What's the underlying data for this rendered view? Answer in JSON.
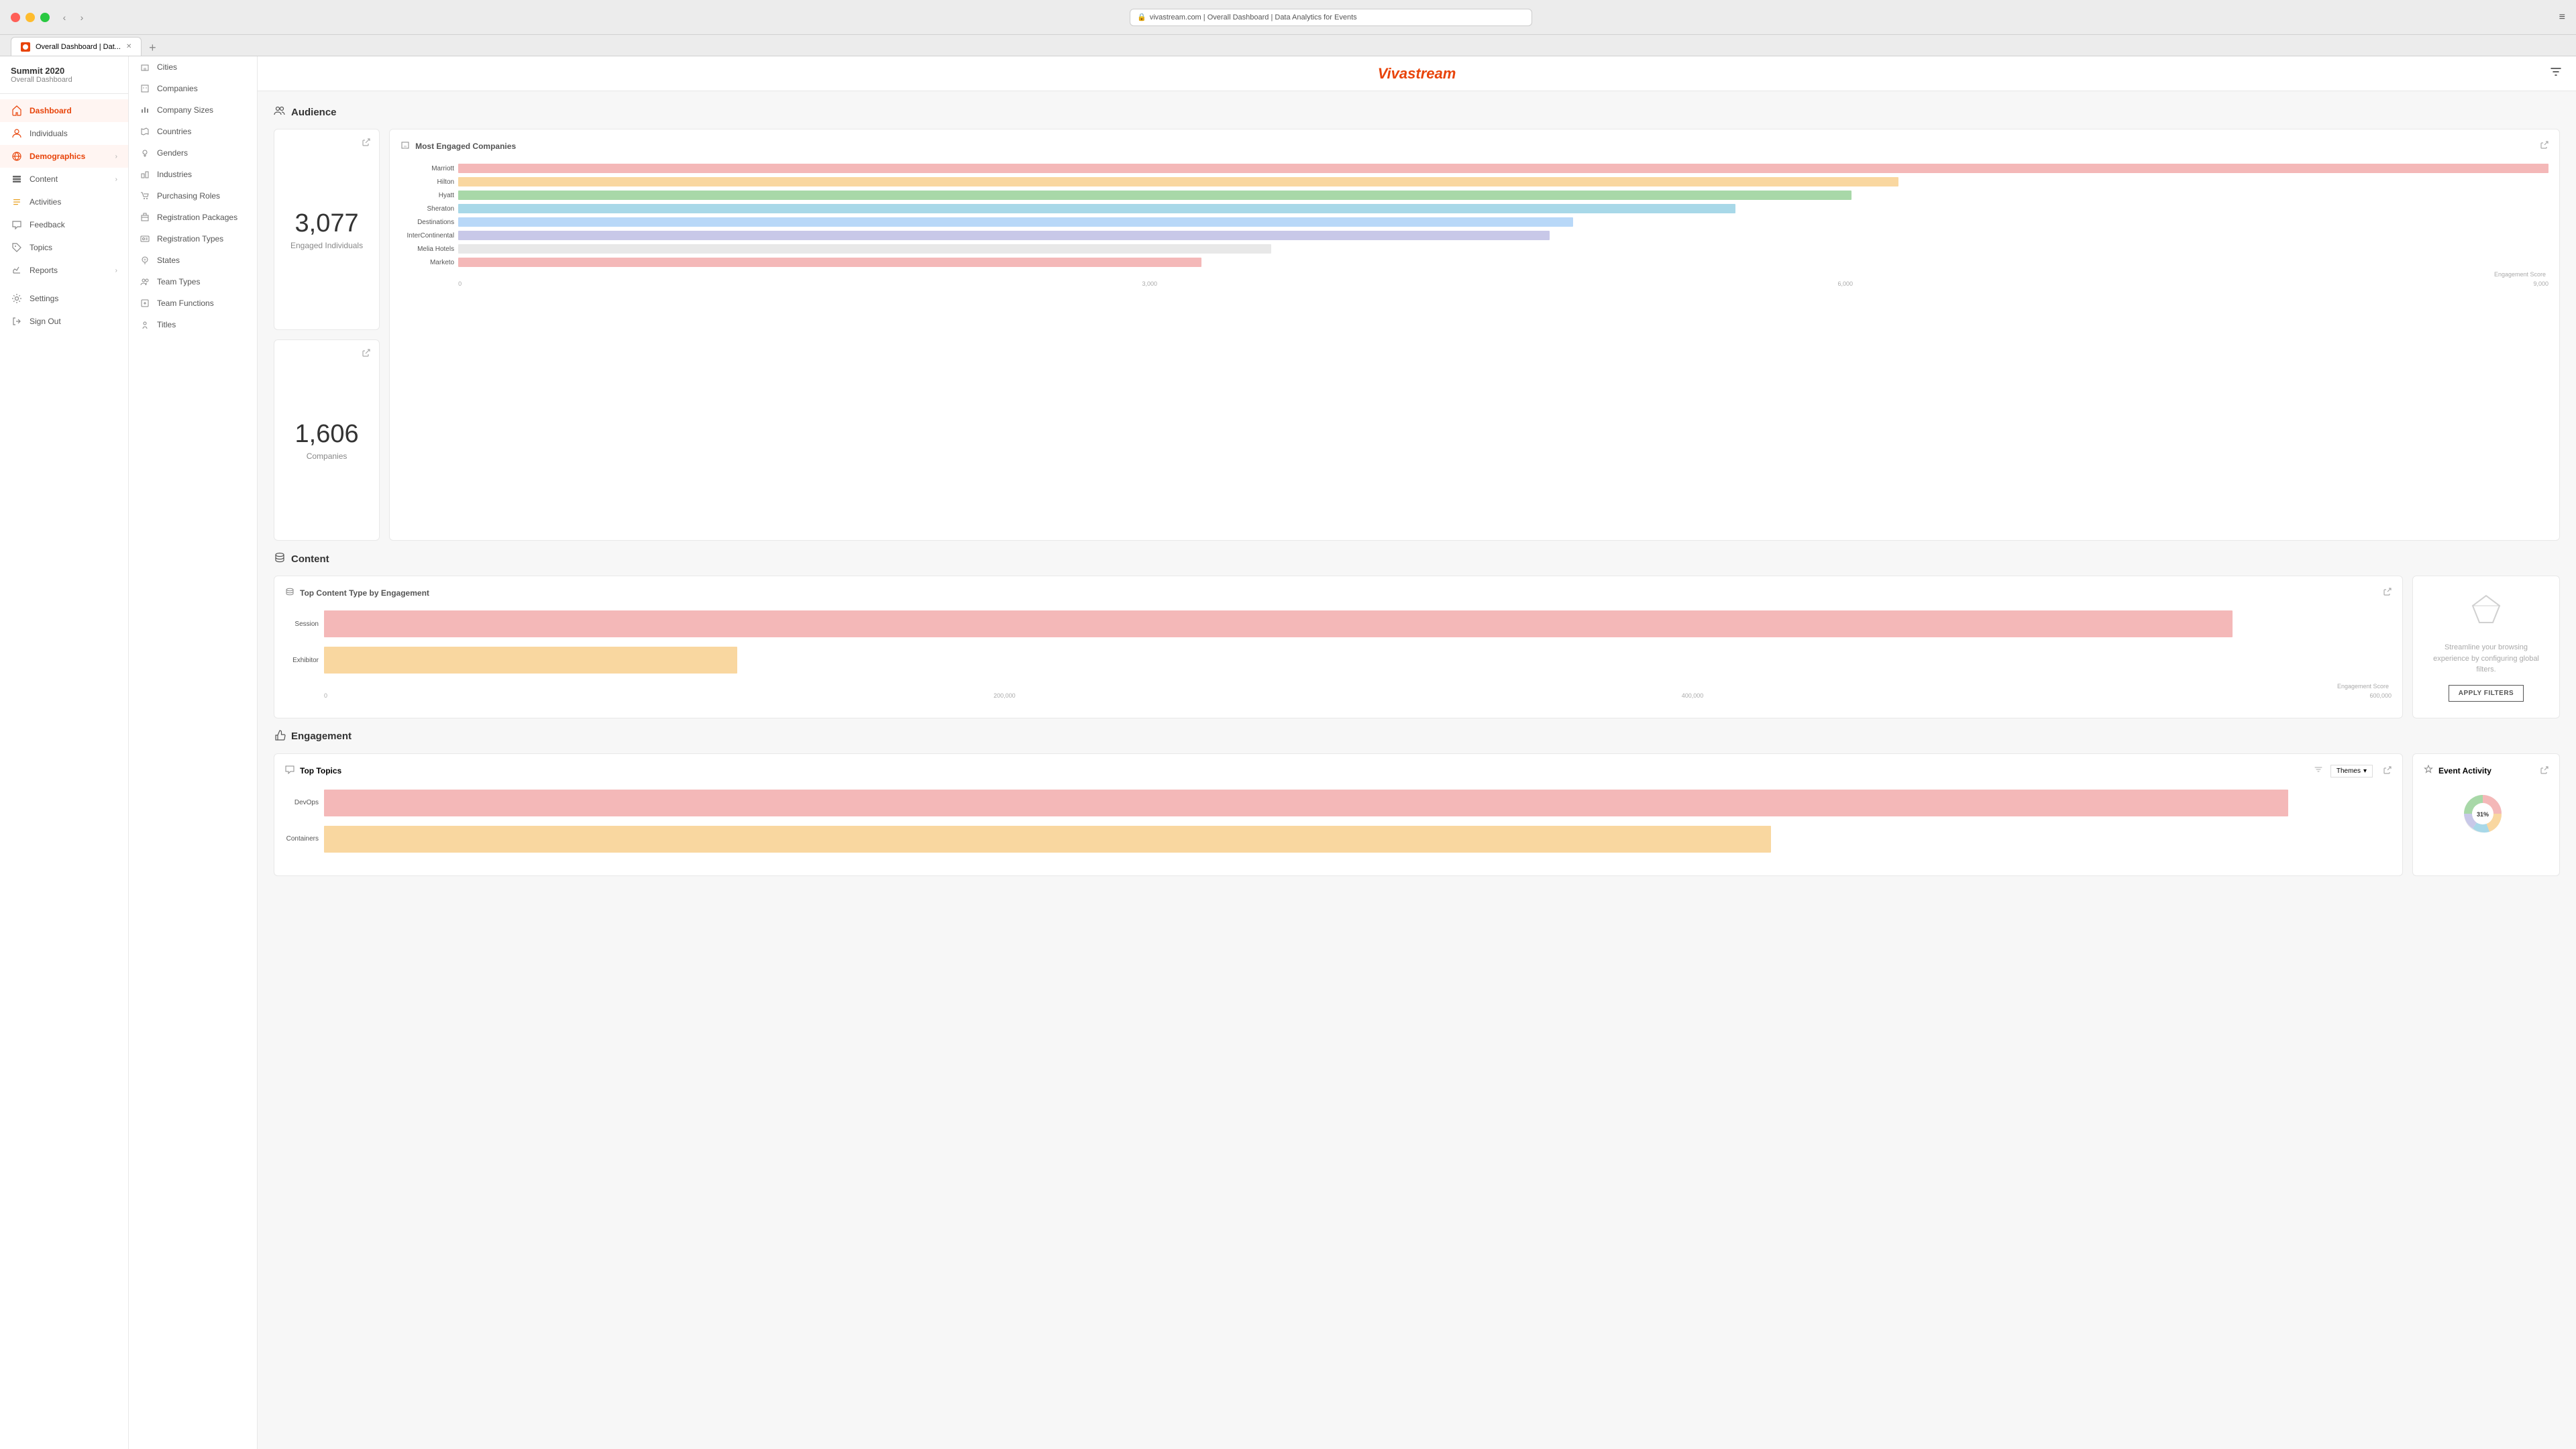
{
  "browser": {
    "url": "vivastream.com | Overall Dashboard | Data Analytics for Events",
    "tab_label": "Overall Dashboard | Dat...",
    "menu_icon": "≡"
  },
  "sidebar": {
    "app_name": "Summit 2020",
    "app_sub": "Overall Dashboard",
    "items": [
      {
        "id": "dashboard",
        "label": "Dashboard",
        "icon": "home",
        "active": true
      },
      {
        "id": "individuals",
        "label": "Individuals",
        "icon": "person"
      },
      {
        "id": "demographics",
        "label": "Demographics",
        "icon": "globe",
        "has_submenu": true,
        "active_sub": true
      },
      {
        "id": "content",
        "label": "Content",
        "icon": "layers",
        "has_submenu": true
      },
      {
        "id": "activities",
        "label": "Activities",
        "icon": "list"
      },
      {
        "id": "feedback",
        "label": "Feedback",
        "icon": "chat"
      },
      {
        "id": "topics",
        "label": "Topics",
        "icon": "tag"
      },
      {
        "id": "reports",
        "label": "Reports",
        "icon": "chart",
        "has_submenu": true
      },
      {
        "id": "settings",
        "label": "Settings",
        "icon": "gear"
      },
      {
        "id": "signout",
        "label": "Sign Out",
        "icon": "exit"
      }
    ]
  },
  "submenu": {
    "items": [
      {
        "id": "cities",
        "label": "Cities",
        "icon": "building"
      },
      {
        "id": "companies",
        "label": "Companies",
        "icon": "office"
      },
      {
        "id": "company-sizes",
        "label": "Company Sizes",
        "icon": "chart-bar"
      },
      {
        "id": "countries",
        "label": "Countries",
        "icon": "map"
      },
      {
        "id": "genders",
        "label": "Genders",
        "icon": "gender"
      },
      {
        "id": "industries",
        "label": "Industries",
        "icon": "industry"
      },
      {
        "id": "purchasing-roles",
        "label": "Purchasing Roles",
        "icon": "cart"
      },
      {
        "id": "registration-packages",
        "label": "Registration Packages",
        "icon": "package"
      },
      {
        "id": "registration-types",
        "label": "Registration Types",
        "icon": "id-card"
      },
      {
        "id": "states",
        "label": "States",
        "icon": "map-pin"
      },
      {
        "id": "team-types",
        "label": "Team Types",
        "icon": "team"
      },
      {
        "id": "team-functions",
        "label": "Team Functions",
        "icon": "function"
      },
      {
        "id": "titles",
        "label": "Titles",
        "icon": "title"
      }
    ]
  },
  "header": {
    "brand": "Vivastream",
    "filter_icon": "⊟"
  },
  "audience": {
    "section_label": "Audience",
    "engaged_individuals": "3,077",
    "engaged_individuals_label": "Engaged Individuals",
    "companies_count": "1,606",
    "companies_label": "Companies",
    "most_engaged_title": "Most Engaged Companies",
    "companies_chart": [
      {
        "name": "Marriott",
        "value": 9000,
        "color": "#f4b8b8"
      },
      {
        "name": "Hilton",
        "value": 6200,
        "color": "#f9d7a0"
      },
      {
        "name": "Hyatt",
        "value": 6000,
        "color": "#a8d8a8"
      },
      {
        "name": "Sheraton",
        "value": 5500,
        "color": "#a8d8e8"
      },
      {
        "name": "Destinations",
        "value": 4800,
        "color": "#b8d8f8"
      },
      {
        "name": "InterContinental",
        "value": 4700,
        "color": "#c8c8e8"
      },
      {
        "name": "Melia Hotels",
        "value": 3500,
        "color": "#e8e8e8"
      },
      {
        "name": "Marketo",
        "value": 3200,
        "color": "#f4b8b8"
      }
    ],
    "chart_axis": [
      "0",
      "3,000",
      "6,000",
      "9,000"
    ],
    "engagement_score_label": "Engagement Score"
  },
  "content": {
    "section_label": "Content",
    "top_content_title": "Top Content Type by Engagement",
    "chart_items": [
      {
        "label": "Session",
        "value": 600000,
        "max": 650000,
        "color": "#f4b8b8"
      },
      {
        "label": "Exhibitor",
        "value": 130000,
        "max": 650000,
        "color": "#f9d7a0"
      }
    ],
    "axis": [
      "0",
      "200,000",
      "400,000",
      "600,000"
    ],
    "engagement_score_label": "Engagement Score",
    "filter_panel": {
      "text": "Streamline your browsing experience by configuring global filters.",
      "button_label": "APPLY FILTERS"
    }
  },
  "engagement": {
    "section_label": "Engagement",
    "top_topics_title": "Top Topics",
    "themes_label": "Themes",
    "topics": [
      {
        "label": "DevOps",
        "value": 95,
        "color": "#f4b8b8"
      },
      {
        "label": "Containers",
        "value": 70,
        "color": "#f9d7a0"
      }
    ],
    "event_activity_title": "Event Activity",
    "pie_percent": "31%"
  }
}
